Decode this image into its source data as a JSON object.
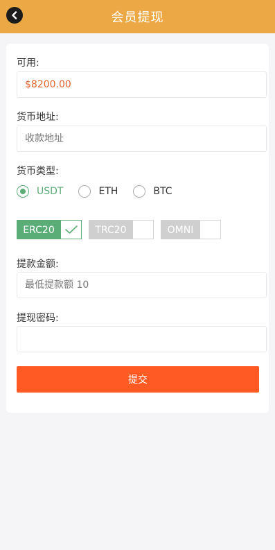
{
  "header": {
    "title": "会员提现",
    "back_icon": "chevron-left-icon"
  },
  "form": {
    "available_label": "可用:",
    "available_value": "$8200.00",
    "address_label": "货币地址:",
    "address_placeholder": "收款地址",
    "currency_type_label": "货币类型:",
    "currencies": [
      {
        "label": "USDT",
        "selected": true
      },
      {
        "label": "ETH",
        "selected": false
      },
      {
        "label": "BTC",
        "selected": false
      }
    ],
    "networks": [
      {
        "label": "ERC20",
        "selected": true
      },
      {
        "label": "TRC20",
        "selected": false
      },
      {
        "label": "OMNI",
        "selected": false
      }
    ],
    "amount_label": "提款金额:",
    "amount_placeholder": "最低提款额 10",
    "password_label": "提现密码:",
    "password_value": "",
    "submit_label": "提交"
  },
  "colors": {
    "header_bg": "#eca844",
    "accent_green": "#5aad76",
    "submit_bg": "#ff5a23",
    "amount_text": "#e4632c"
  }
}
